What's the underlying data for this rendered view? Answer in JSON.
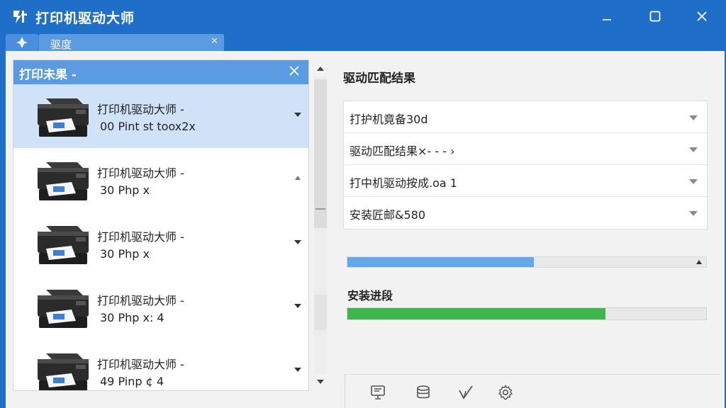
{
  "window": {
    "title": "打印机驱动大师"
  },
  "tab": {
    "label": "驱度"
  },
  "left_panel": {
    "title": "打印未果 -",
    "items": [
      {
        "name": "打印机驱动大师 -",
        "sub": "00 Pint st toox2x",
        "selected": true
      },
      {
        "name": "打印机驱动大师 -",
        "sub": "30 Php x",
        "selected": false
      },
      {
        "name": "打印机驱动大师 -",
        "sub": "30 Php x",
        "selected": false
      },
      {
        "name": "打印机驱动大师 -",
        "sub": "30 Php x: 4",
        "selected": false
      },
      {
        "name": "打印机驱动大师 -",
        "sub": "49 Pinp ¢ 4",
        "selected": false
      }
    ]
  },
  "right_panel": {
    "title": "驱动匹配结果",
    "dropdowns": [
      {
        "label": "打护机竟备30d"
      },
      {
        "label": "驱动匹配结果×- - - ›"
      },
      {
        "label": "打中机驱动按成.oa 1"
      },
      {
        "label": "安装匠邮&580"
      }
    ],
    "match_progress": 0.52,
    "install_label": "安装进段",
    "install_progress": 0.72
  },
  "toolbar": {
    "icons": [
      "monitor-icon",
      "database-icon",
      "check-icon",
      "settings-icon"
    ]
  },
  "colors": {
    "title_bar": "#1f6fc9",
    "header": "#5b9be2",
    "selected_row": "#cfe2f7",
    "match_bar": "#64a8ea",
    "install_bar": "#3fb54e"
  }
}
